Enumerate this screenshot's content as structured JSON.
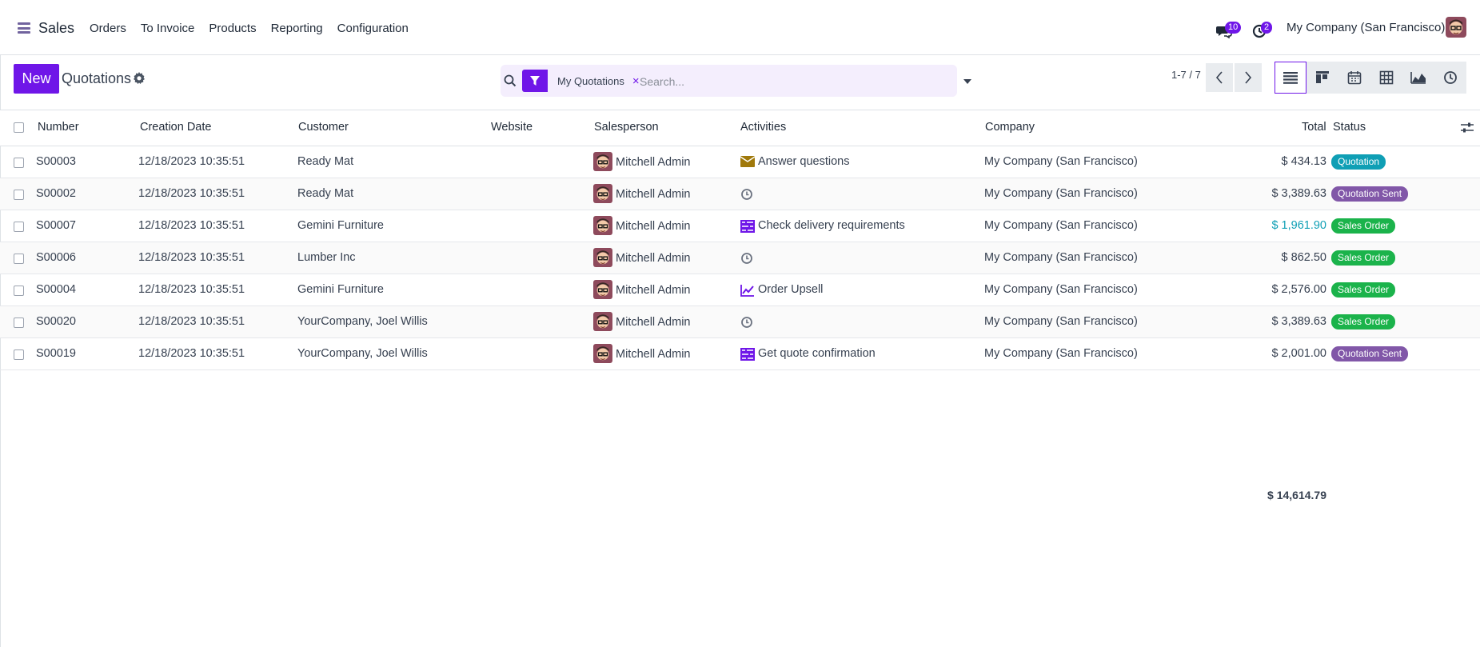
{
  "navbar": {
    "app_name": "Sales",
    "menu": [
      "Orders",
      "To Invoice",
      "Products",
      "Reporting",
      "Configuration"
    ],
    "messages_count": "10",
    "activities_count": "2",
    "company": "My Company (San Francisco)"
  },
  "control_panel": {
    "new_label": "New",
    "breadcrumb": "Quotations",
    "facet_label": "My Quotations",
    "facet_remove": "×",
    "search_placeholder": "Search...",
    "pager": "1-7 / 7",
    "views": [
      "list-view-icon",
      "kanban-view-icon",
      "calendar-view-icon",
      "pivot-view-icon",
      "graph-view-icon",
      "activity-view-icon"
    ]
  },
  "table": {
    "headers": {
      "number": "Number",
      "creation_date": "Creation Date",
      "customer": "Customer",
      "website": "Website",
      "salesperson": "Salesperson",
      "activities": "Activities",
      "company": "Company",
      "total": "Total",
      "status": "Status"
    },
    "rows": [
      {
        "number": "S00003",
        "date": "12/18/2023 10:35:51",
        "customer": "Ready Mat",
        "salesperson": "Mitchell Admin",
        "activity_icon": "envelope-icon",
        "activity": "Answer questions",
        "company": "My Company (San Francisco)",
        "total": "$ 434.13",
        "status": "Quotation",
        "status_color": "#0f9fb5"
      },
      {
        "number": "S00002",
        "date": "12/18/2023 10:35:51",
        "customer": "Ready Mat",
        "salesperson": "Mitchell Admin",
        "activity_icon": "clock-icon",
        "activity": "",
        "company": "My Company (San Francisco)",
        "total": "$ 3,389.63",
        "status": "Quotation Sent",
        "status_color": "#8157a8"
      },
      {
        "number": "S00007",
        "date": "12/18/2023 10:35:51",
        "customer": "Gemini Furniture",
        "salesperson": "Mitchell Admin",
        "activity_icon": "tasks-icon",
        "activity": "Check delivery requirements",
        "company": "My Company (San Francisco)",
        "total": "$ 1,961.90",
        "total_color": "#0f9fb5",
        "status": "Sales Order",
        "status_color": "#1bb34b"
      },
      {
        "number": "S00006",
        "date": "12/18/2023 10:35:51",
        "customer": "Lumber Inc",
        "salesperson": "Mitchell Admin",
        "activity_icon": "clock-icon",
        "activity": "",
        "company": "My Company (San Francisco)",
        "total": "$ 862.50",
        "status": "Sales Order",
        "status_color": "#1bb34b"
      },
      {
        "number": "S00004",
        "date": "12/18/2023 10:35:51",
        "customer": "Gemini Furniture",
        "salesperson": "Mitchell Admin",
        "activity_icon": "chart-line-icon",
        "activity": "Order Upsell",
        "company": "My Company (San Francisco)",
        "total": "$ 2,576.00",
        "status": "Sales Order",
        "status_color": "#1bb34b"
      },
      {
        "number": "S00020",
        "date": "12/18/2023 10:35:51",
        "customer": "YourCompany, Joel Willis",
        "salesperson": "Mitchell Admin",
        "activity_icon": "clock-icon",
        "activity": "",
        "company": "My Company (San Francisco)",
        "total": "$ 3,389.63",
        "status": "Sales Order",
        "status_color": "#1bb34b"
      },
      {
        "number": "S00019",
        "date": "12/18/2023 10:35:51",
        "customer": "YourCompany, Joel Willis",
        "salesperson": "Mitchell Admin",
        "activity_icon": "tasks-icon",
        "activity": "Get quote confirmation",
        "company": "My Company (San Francisco)",
        "total": "$ 2,001.00",
        "status": "Quotation Sent",
        "status_color": "#8157a8"
      }
    ],
    "sum_total": "$ 14,614.79"
  },
  "colors": {
    "accent": "#6f16e8",
    "quotation": "#0f9fb5",
    "sent": "#8157a8",
    "sales_order": "#1bb34b"
  }
}
